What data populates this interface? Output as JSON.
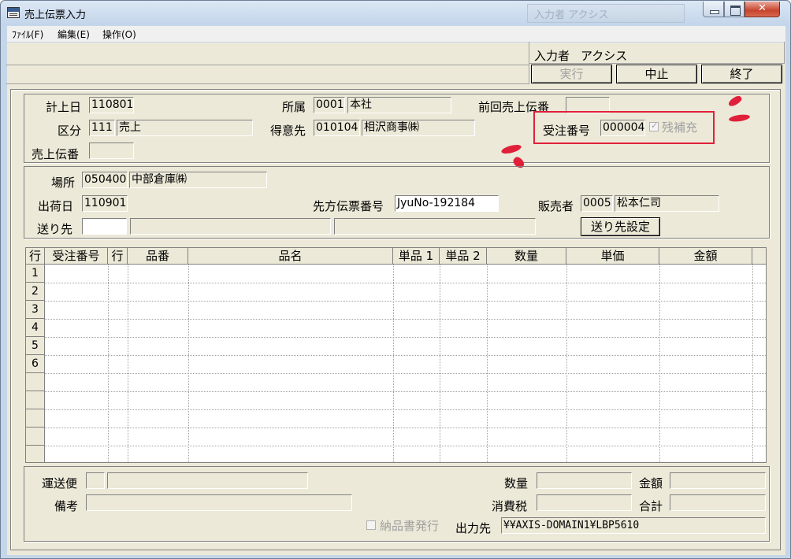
{
  "window": {
    "title": "売上伝票入力",
    "background_title": "入力者 アクシス"
  },
  "menu": [
    "ﾌｧｲﾙ(F)",
    "編集(E)",
    "操作(O)"
  ],
  "toolbar": {
    "operator_label": "入力者",
    "operator_name": "アクシス",
    "execute": "実行",
    "cancel": "中止",
    "exit": "終了"
  },
  "header": {
    "date_label": "計上日",
    "date": "110801",
    "dept_label": "所属",
    "dept_code": "0001",
    "dept_name": "本社",
    "prev_slip_label": "前回売上伝番",
    "prev_slip": "",
    "kubun_label": "区分",
    "kubun_code": "111",
    "kubun_name": "売上",
    "customer_label": "得意先",
    "customer_code": "010104",
    "customer_name": "相沢商事㈱",
    "order_no_label": "受注番号",
    "order_no": "000004",
    "remaining_label": "残補充",
    "slip_no_label": "売上伝番",
    "slip_no": ""
  },
  "shipping": {
    "location_label": "場所",
    "location_code": "050400",
    "location_name": "中部倉庫㈱",
    "ship_date_label": "出荷日",
    "ship_date": "110901",
    "client_slip_label": "先方伝票番号",
    "client_slip": "JyuNo-192184",
    "seller_label": "販売者",
    "seller_code": "0005",
    "seller_name": "松本仁司",
    "destination_label": "送り先",
    "destination_button": "送り先設定"
  },
  "grid": {
    "columns": [
      "行",
      "受注番号",
      "行",
      "品番",
      "品名",
      "単品 1",
      "単品 2",
      "数量",
      "単価",
      "金額"
    ],
    "rows": [
      "1",
      "2",
      "3",
      "4",
      "5",
      "6",
      "",
      "",
      "",
      "",
      ""
    ]
  },
  "footer": {
    "carrier_label": "運送便",
    "memo_label": "備考",
    "qty_label": "数量",
    "amount_label": "金額",
    "tax_label": "消費税",
    "total_label": "合計",
    "delivery_note_label": "納品書発行",
    "output_label": "出力先",
    "output_value": "¥¥AXIS-DOMAIN1¥LBP5610"
  },
  "colors": {
    "highlight": "#e0203a",
    "form_background": "#ece9d8"
  }
}
